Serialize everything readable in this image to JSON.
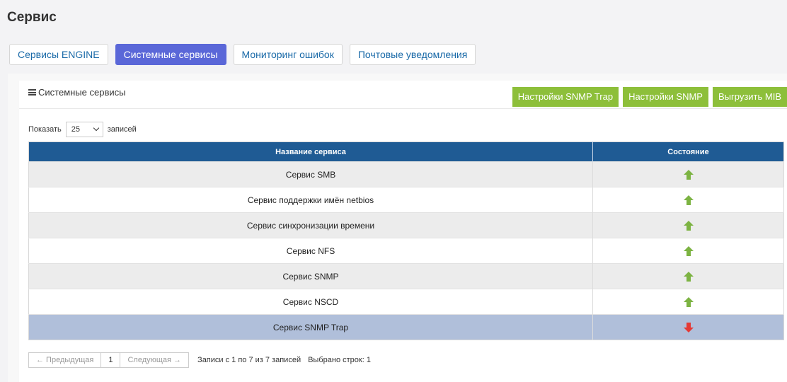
{
  "page": {
    "title": "Сервис"
  },
  "tabs": [
    {
      "label": "Сервисы ENGINE",
      "active": false
    },
    {
      "label": "Системные сервисы",
      "active": true
    },
    {
      "label": "Мониторинг ошибок",
      "active": false
    },
    {
      "label": "Почтовые уведомления",
      "active": false
    }
  ],
  "panel": {
    "title": "Системные сервисы",
    "title_icon": "menu-icon",
    "buttons": [
      "Настройки SNMP Trap",
      "Настройки SNMP",
      "Выгрузить MIB"
    ]
  },
  "length_menu": {
    "prefix": "Показать",
    "value": "25",
    "suffix": "записей"
  },
  "table": {
    "columns": [
      "Название сервиса",
      "Состояние"
    ],
    "rows": [
      {
        "name": "Сервис SMB",
        "status": "up"
      },
      {
        "name": "Сервис поддержки имён netbios",
        "status": "up"
      },
      {
        "name": "Сервис синхронизации времени",
        "status": "up"
      },
      {
        "name": "Сервис NFS",
        "status": "up"
      },
      {
        "name": "Сервис SNMP",
        "status": "up"
      },
      {
        "name": "Сервис NSCD",
        "status": "up"
      },
      {
        "name": "Сервис SNMP Trap",
        "status": "down",
        "selected": true
      }
    ]
  },
  "pagination": {
    "prev": "← Предыдущая",
    "page": "1",
    "next": "Следующая →",
    "info": "Записи с 1 по 7 из 7 записей",
    "selected_info": "Выбрано строк: 1"
  },
  "colors": {
    "accent": "#5a67d8",
    "button_green": "#8dbf3a",
    "header_blue": "#1f5b94",
    "status_up": "#7cb342",
    "status_down": "#e53935",
    "selected_row": "#b0bfda"
  }
}
